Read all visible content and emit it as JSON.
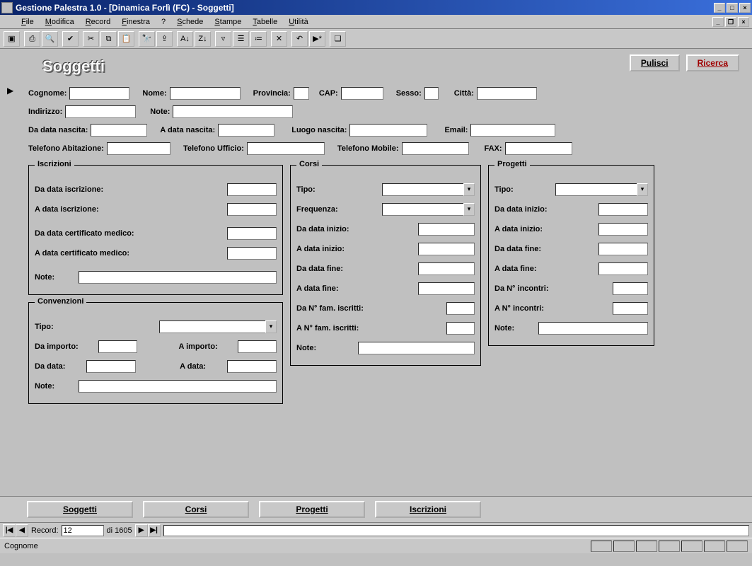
{
  "window": {
    "title": "Gestione Palestra 1.0 - [Dinamica Forlì (FC) - Soggetti]"
  },
  "menu": {
    "items": [
      {
        "label": "File",
        "u": 0
      },
      {
        "label": "Modifica",
        "u": 0
      },
      {
        "label": "Record",
        "u": 0
      },
      {
        "label": "Finestra",
        "u": 0
      },
      {
        "label": "?",
        "u": -1
      },
      {
        "label": "Schede",
        "u": 0
      },
      {
        "label": "Stampe",
        "u": 0
      },
      {
        "label": "Tabelle",
        "u": 0
      },
      {
        "label": "Utilità",
        "u": 0
      }
    ]
  },
  "page": {
    "title": "Soggetti",
    "pulisci": "Pulisci",
    "ricerca": "Ricerca"
  },
  "fields": {
    "cognome_lbl": "Cognome:",
    "nome_lbl": "Nome:",
    "provincia_lbl": "Provincia:",
    "cap_lbl": "CAP:",
    "sesso_lbl": "Sesso:",
    "citta_lbl": "Città:",
    "indirizzo_lbl": "Indirizzo:",
    "note_lbl": "Note:",
    "da_nasc_lbl": "Da data nascita:",
    "a_nasc_lbl": "A data nascita:",
    "luogo_nasc_lbl": "Luogo nascita:",
    "email_lbl": "Email:",
    "tel_abit_lbl": "Telefono Abitazione:",
    "tel_uff_lbl": "Telefono Ufficio:",
    "tel_mob_lbl": "Telefono Mobile:",
    "fax_lbl": "FAX:"
  },
  "iscrizioni": {
    "legend": "Iscrizioni",
    "da_iscr": "Da data iscrizione:",
    "a_iscr": "A data iscrizione:",
    "da_cert": "Da data certificato medico:",
    "a_cert": "A data certificato medico:",
    "note": "Note:"
  },
  "convenzioni": {
    "legend": "Convenzioni",
    "tipo": "Tipo:",
    "da_imp": "Da importo:",
    "a_imp": "A importo:",
    "da_data": "Da data:",
    "a_data": "A data:",
    "note": "Note:"
  },
  "corsi": {
    "legend": "Corsi",
    "tipo": "Tipo:",
    "freq": "Frequenza:",
    "da_inizio": "Da data inizio:",
    "a_inizio": "A data inizio:",
    "da_fine": "Da data fine:",
    "a_fine": "A data fine:",
    "da_fam": "Da N° fam. iscritti:",
    "a_fam": "A N° fam. iscritti:",
    "note": "Note:"
  },
  "progetti": {
    "legend": "Progetti",
    "tipo": "Tipo:",
    "da_inizio": "Da data inizio:",
    "a_inizio": "A data inizio:",
    "da_fine": "Da data fine:",
    "a_fine": "A data fine:",
    "da_inc": "Da N° incontri:",
    "a_inc": "A N° incontri:",
    "note": "Note:"
  },
  "navbtn": {
    "soggetti": "Soggetti",
    "corsi": "Corsi",
    "progetti": "Progetti",
    "iscrizioni": "Iscrizioni"
  },
  "recordnav": {
    "label": "Record:",
    "current": "12",
    "total": "di 1605"
  },
  "status": {
    "text": "Cognome"
  }
}
